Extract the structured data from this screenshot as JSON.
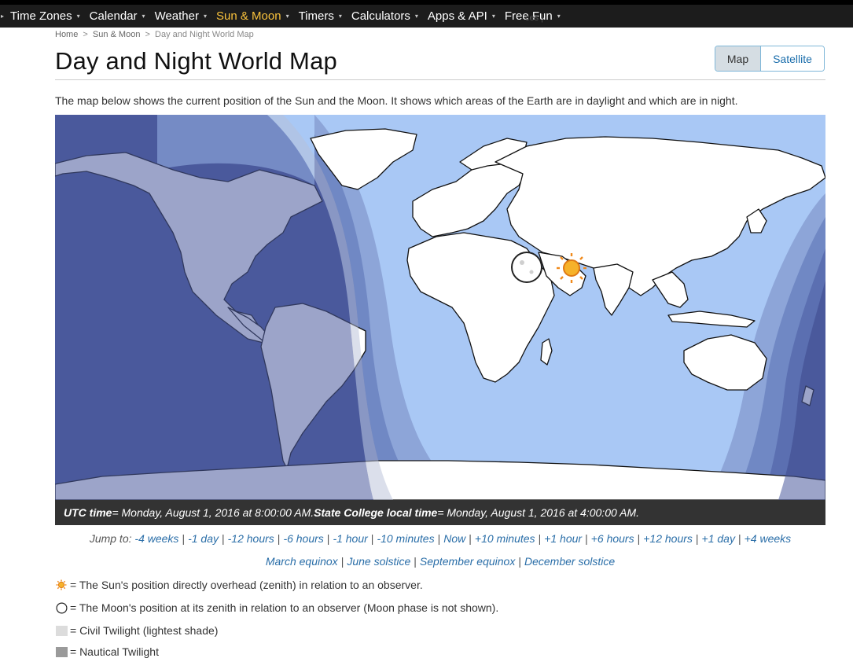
{
  "nav": {
    "items": [
      {
        "label": "Time Zones",
        "active": false
      },
      {
        "label": "Calendar",
        "active": false
      },
      {
        "label": "Weather",
        "active": false
      },
      {
        "label": "Sun & Moon",
        "active": true
      },
      {
        "label": "Timers",
        "active": false
      },
      {
        "label": "Calculators",
        "active": false
      },
      {
        "label": "Apps & API",
        "active": false
      },
      {
        "label": "Free Fun",
        "active": false
      }
    ],
    "ghost_text": "ces |"
  },
  "breadcrumb": {
    "home": "Home",
    "section": "Sun & Moon",
    "current": "Day and Night World Map",
    "separator": ">"
  },
  "page": {
    "title": "Day and Night World Map",
    "intro": "The map below shows the current position of the Sun and the Moon. It shows which areas of the Earth are in daylight and which are in night."
  },
  "view_toggle": {
    "map_label": "Map",
    "satellite_label": "Satellite",
    "selected": "Map"
  },
  "time_bar": {
    "utc_label": "UTC time",
    "utc_value": " = Monday, August 1, 2016 at 8:00:00 AM. ",
    "local_label": "State College local time",
    "local_value": " = Monday, August 1, 2016 at 4:00:00 AM."
  },
  "jump": {
    "prefix": "Jump to: ",
    "links": [
      "-4 weeks",
      "-1 day",
      "-12 hours",
      "-6 hours",
      "-1 hour",
      "-10 minutes",
      "Now",
      "+10 minutes",
      "+1 hour",
      "+6 hours",
      "+12 hours",
      "+1 day",
      "+4 weeks"
    ],
    "season_links": [
      "March equinox",
      "June solstice",
      "September equinox",
      "December solstice"
    ]
  },
  "legend": {
    "sun": "= The Sun's position directly overhead (zenith) in relation to an observer.",
    "moon": "= The Moon's position at its zenith in relation to an observer (Moon phase is not shown).",
    "civil": "= Civil Twilight (lightest shade)",
    "nautical": "= Nautical Twilight"
  },
  "colors": {
    "ocean_day": "#a9c8f5",
    "land": "#ffffff",
    "civil_twilight": "#d9dde5",
    "night": "#4a5a9c",
    "nav_bg": "#1c1c1c",
    "nav_active": "#f9c23c",
    "link": "#2a6ea8"
  },
  "icons": {
    "sun": "sun-icon",
    "moon": "moon-icon"
  }
}
